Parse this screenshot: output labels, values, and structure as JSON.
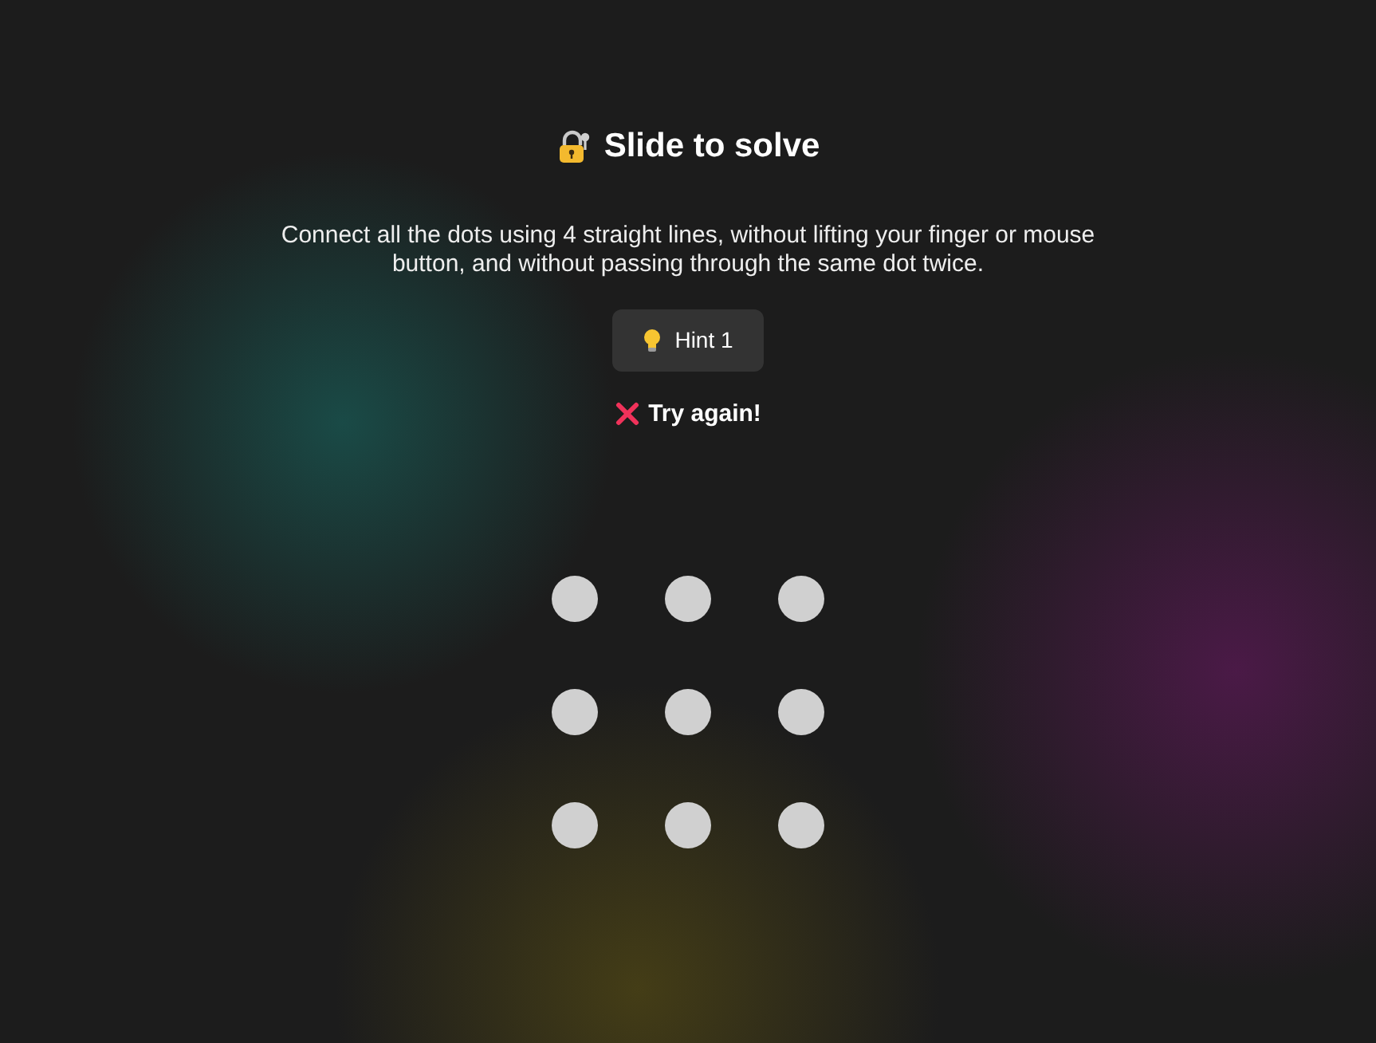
{
  "title": "Slide to solve",
  "instructions": "Connect all the dots using 4 straight lines, without lifting your finger or mouse button, and without passing through the same dot twice.",
  "hint_button": {
    "label": "Hint 1"
  },
  "status": {
    "kind": "error",
    "text": "Try again!"
  }
}
